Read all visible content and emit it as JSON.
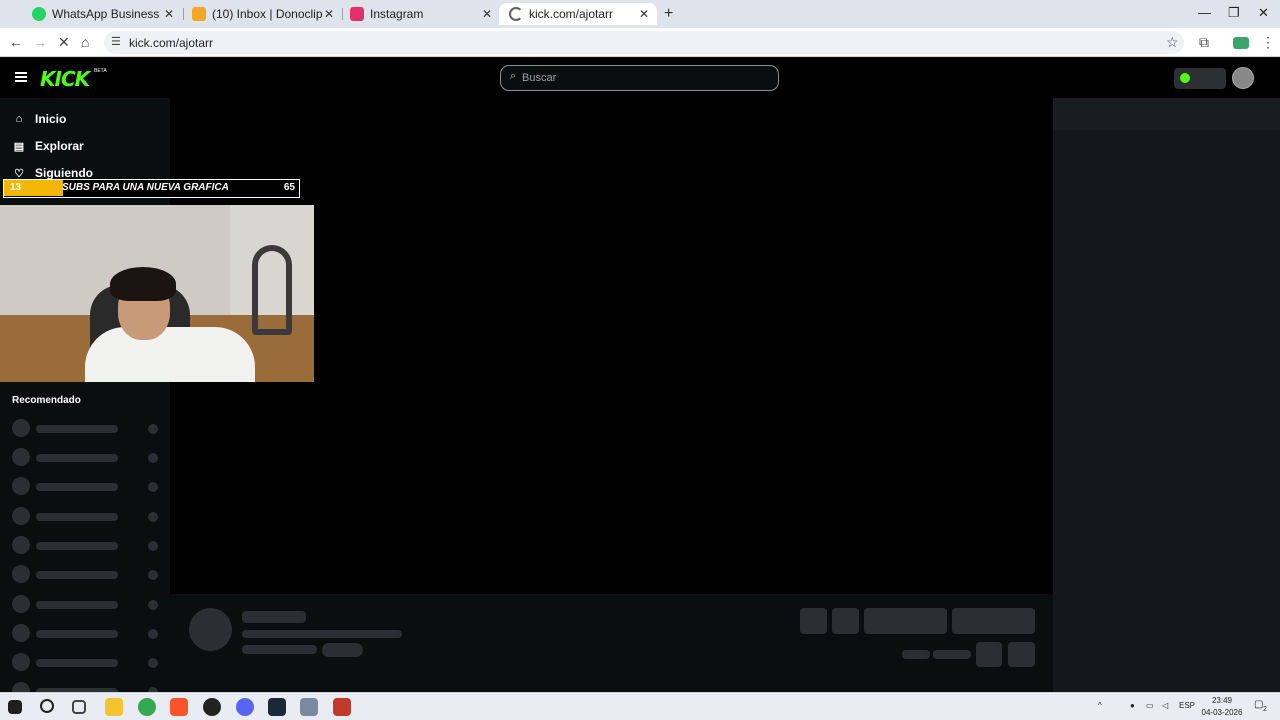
{
  "browser": {
    "tabs": [
      {
        "title": "WhatsApp Business",
        "icon": "whatsapp-icon",
        "color": "#25d366"
      },
      {
        "title": "(10) Inbox | Donoclip",
        "icon": "donoclip-icon",
        "color": "#f5a623"
      },
      {
        "title": "Instagram",
        "icon": "instagram-icon",
        "color": "#e1306c"
      },
      {
        "title": "kick.com/ajotarr",
        "icon": "loading-icon",
        "color": "#5f6368"
      }
    ],
    "new_tab": "+",
    "address": "kick.com/ajotarr",
    "controls": {
      "minimize": "—",
      "restore": "❐",
      "close": "✕"
    }
  },
  "kick": {
    "logo": "KICK",
    "logo_badge": "BETA",
    "brand_color": "#53fc18",
    "search_placeholder": "Buscar",
    "nav": [
      {
        "label": "Inicio",
        "icon": "home-icon"
      },
      {
        "label": "Explorar",
        "icon": "explore-icon"
      },
      {
        "label": "Siguiendo",
        "icon": "heart-icon"
      }
    ],
    "recommended_title": "Recomendado"
  },
  "overlay": {
    "current": "13",
    "goal": "65",
    "text": "SUBS PARA UNA NUEVA GRAFICA",
    "progress": 0.2,
    "fill_color": "#f2b705"
  },
  "taskbar": {
    "language": "ESP",
    "time": "23:49",
    "date": "04-03-2026",
    "notifications": "2"
  }
}
